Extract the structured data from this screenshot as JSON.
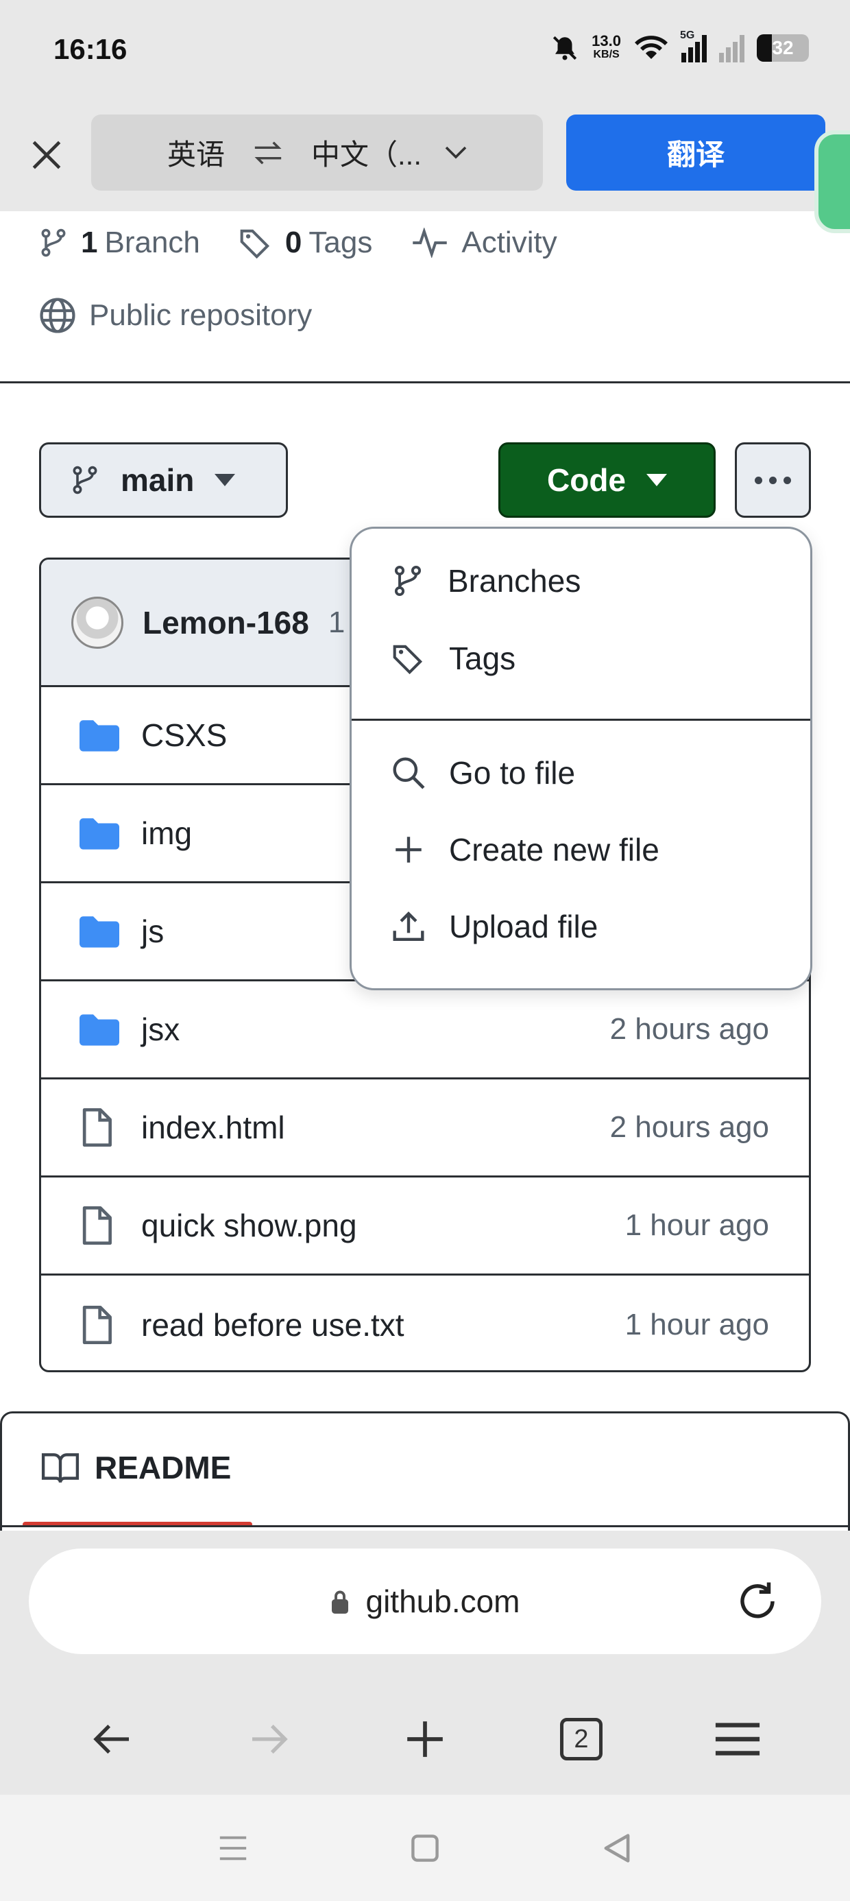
{
  "status_bar": {
    "time": "16:16",
    "net_speed_value": "13.0",
    "net_speed_unit": "KB/S",
    "network_type": "5G",
    "battery": "32"
  },
  "translate_bar": {
    "source_lang": "英语",
    "target_lang": "中文（...",
    "translate_button": "翻译"
  },
  "repo_meta": {
    "branch_count": "1",
    "branch_label": "Branch",
    "tag_count": "0",
    "tag_label": "Tags",
    "activity_label": "Activity",
    "visibility_label": "Public repository"
  },
  "toolbar": {
    "branch_name": "main",
    "code_label": "Code"
  },
  "commit": {
    "author": "Lemon-168",
    "extra": "1"
  },
  "files": [
    {
      "type": "folder",
      "name": "CSXS",
      "time": ""
    },
    {
      "type": "folder",
      "name": "img",
      "time": ""
    },
    {
      "type": "folder",
      "name": "js",
      "time": ""
    },
    {
      "type": "folder",
      "name": "jsx",
      "time": "2 hours ago"
    },
    {
      "type": "file",
      "name": "index.html",
      "time": "2 hours ago"
    },
    {
      "type": "file",
      "name": "quick show.png",
      "time": "1 hour ago"
    },
    {
      "type": "file",
      "name": "read before use.txt",
      "time": "1 hour ago"
    }
  ],
  "dropdown": {
    "branches": "Branches",
    "tags": "Tags",
    "go_to_file": "Go to file",
    "create_new_file": "Create new file",
    "upload_file": "Upload file"
  },
  "readme": {
    "title": "README"
  },
  "browser": {
    "url": "github.com",
    "tab_count": "2"
  },
  "colors": {
    "code_button": "#0b5e1d",
    "translate_button": "#1f6fea",
    "folder": "#3e8ef5",
    "readme_underline": "#d43c33"
  }
}
